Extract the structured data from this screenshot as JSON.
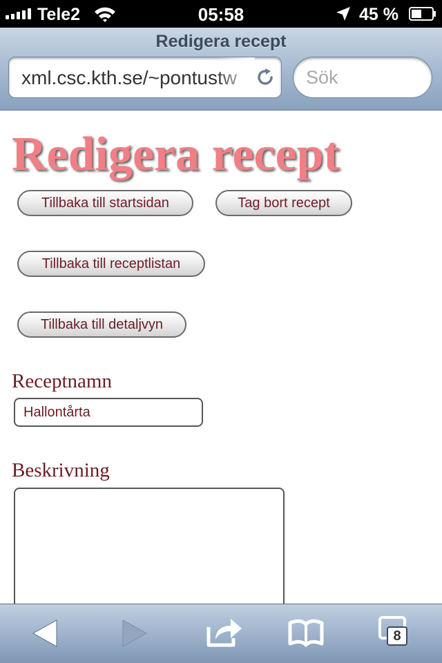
{
  "status_bar": {
    "carrier": "Tele2",
    "time": "05:58",
    "battery_percent": "45 %"
  },
  "browser": {
    "page_title": "Redigera recept",
    "url": "xml.csc.kth.se/~pontustw",
    "search_placeholder": "Sök",
    "tab_count": "8"
  },
  "page": {
    "heading": "Redigera recept",
    "buttons": {
      "back_home": "Tillbaka till startsidan",
      "delete_recipe": "Tag bort recept",
      "back_list": "Tillbaka till receptlistan",
      "back_detail": "Tillbaka till detaljvyn"
    },
    "form": {
      "name_label": "Receptnamn",
      "name_value": "Hallontårta",
      "description_label": "Beskrivning",
      "description_value": ""
    }
  },
  "toolbar": {
    "icons": [
      "back-arrow-icon",
      "forward-arrow-icon",
      "share-icon",
      "bookmarks-book-icon",
      "tabs-icon"
    ]
  }
}
